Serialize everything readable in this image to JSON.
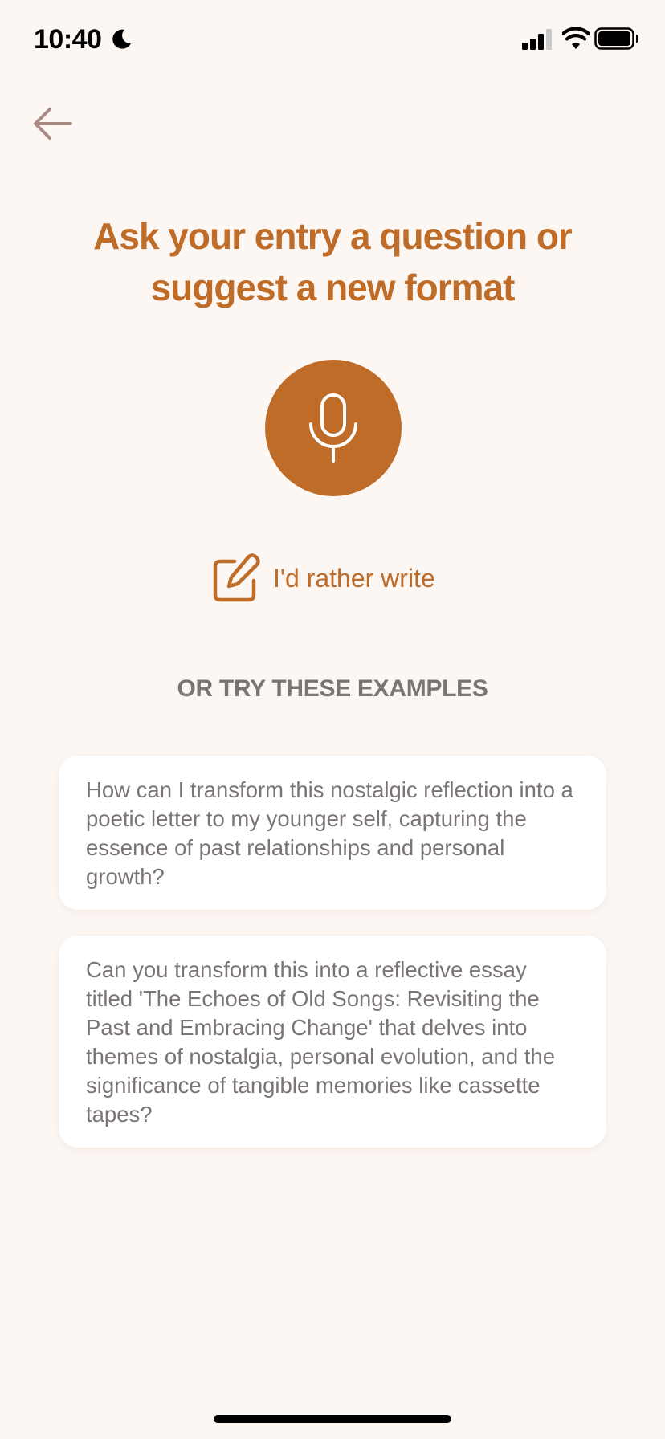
{
  "status_bar": {
    "time": "10:40"
  },
  "colors": {
    "background": "#FDF7F4",
    "accent": "#BE6C27",
    "muted_text": "#7A7472",
    "card_bg": "#FFFFFF"
  },
  "icons": {
    "back": "arrow-left-icon",
    "mic": "microphone-icon",
    "edit": "pencil-square-icon",
    "moon": "moon-icon",
    "signal": "cellular-signal-icon",
    "wifi": "wifi-icon",
    "battery": "battery-icon"
  },
  "page": {
    "title": "Ask your entry a question or suggest a new format",
    "write_label": "I'd rather write",
    "examples_heading": "OR TRY THESE EXAMPLES"
  },
  "examples": [
    {
      "text": "How can I transform this nostalgic reflection into a poetic letter to my younger self, capturing the essence of past relationships and personal growth?"
    },
    {
      "text": "Can you transform this into a reflective essay titled 'The Echoes of Old Songs: Revisiting the Past and Embracing Change' that delves into themes of nostalgia, personal evolution, and the significance of tangible memories like cassette tapes?"
    }
  ]
}
